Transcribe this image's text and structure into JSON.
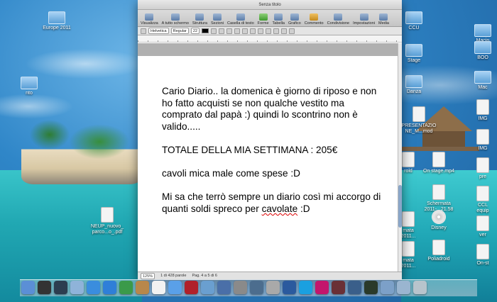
{
  "window": {
    "title": "Senza titolo"
  },
  "toolbar": [
    {
      "label": "Visualizza",
      "icon": "view-icon"
    },
    {
      "label": "A tutto schermo",
      "icon": "fullscreen-icon"
    },
    {
      "label": "Struttura",
      "icon": "structure-icon"
    },
    {
      "label": "Sezioni",
      "icon": "sections-icon"
    },
    {
      "label": "Casella di testo",
      "icon": "textbox-icon"
    },
    {
      "label": "Forme",
      "icon": "shapes-icon"
    },
    {
      "label": "Tabella",
      "icon": "table-icon"
    },
    {
      "label": "Grafico",
      "icon": "chart-icon"
    },
    {
      "label": "Commento",
      "icon": "comment-icon"
    },
    {
      "label": "Condivisione",
      "icon": "share-icon"
    },
    {
      "label": "Impostazioni",
      "icon": "inspector-icon"
    },
    {
      "label": "Media",
      "icon": "media-icon"
    }
  ],
  "format": {
    "font": "Helvetica",
    "style": "Regular",
    "size": "22"
  },
  "document": {
    "paragraphs": [
      "Cario Diario.. la domenica è giorno di riposo e non ho fatto acquisti se non qualche vestito ma comprato dal papà :) quindi  lo scontrino non è valido.....",
      "TOTALE DELLA MIA SETTIMANA : 205€",
      "cavoli mica male come spese :D"
    ],
    "last_paragraph_start": "Mi sa che terrò sempre un diario così mi accorgo di quanti soldi spreco per ",
    "last_paragraph_misspelled": "cavolate",
    "last_paragraph_end": " :D"
  },
  "status": {
    "zoom": "125%",
    "word_count": "1 di 428 parole",
    "page": "Pag. 4 a 5 di 6"
  },
  "desktop": {
    "left_icons": [
      {
        "label": "Europe 2011",
        "icon": "folder-icon"
      },
      {
        "label": "nto",
        "icon": "folder-icon"
      },
      {
        "label": "NEUP_nuovo_\nparco...o_.pdf",
        "icon": "pdf-icon"
      }
    ],
    "right_icons": [
      {
        "label": "CCU",
        "icon": "folder-icon"
      },
      {
        "label": "Stage",
        "icon": "folder-icon"
      },
      {
        "label": "Danza",
        "icon": "folder-icon"
      },
      {
        "label": "PRESENTAZIO\nNE_M...mod",
        "icon": "doc-icon"
      },
      {
        "label": "rold",
        "icon": "doc-icon"
      },
      {
        "label": "On stage.mp4",
        "icon": "video-icon"
      },
      {
        "label": "Schermata\n2011-...21.58",
        "icon": "screenshot-icon"
      },
      {
        "label": "mata\n2011...",
        "icon": "doc-icon"
      },
      {
        "label": "Disney",
        "icon": "disc-icon"
      },
      {
        "label": "mata\n2011...",
        "icon": "doc-icon"
      },
      {
        "label": "Poliadroid",
        "icon": "doc-icon"
      }
    ],
    "far_right_icons": [
      {
        "label": "Macin",
        "icon": "drive-icon"
      },
      {
        "label": "BOO",
        "icon": "drive-icon"
      },
      {
        "label": "Mac",
        "icon": "drive-icon"
      },
      {
        "label": "IMG",
        "icon": "image-icon"
      },
      {
        "label": "IMG",
        "icon": "image-icon"
      },
      {
        "label": "pre",
        "icon": "doc-icon"
      },
      {
        "label": "CCL\nequip",
        "icon": "doc-icon"
      },
      {
        "label": "ver",
        "icon": "doc-icon"
      },
      {
        "label": "On-st",
        "icon": "video-icon"
      }
    ]
  },
  "dock": {
    "apps": [
      {
        "name": "finder",
        "color": "#5b8fd6"
      },
      {
        "name": "dashboard",
        "color": "#333333"
      },
      {
        "name": "mission-control",
        "color": "#2c3e50"
      },
      {
        "name": "preview",
        "color": "#8fb3d9"
      },
      {
        "name": "safari",
        "color": "#3a8dde"
      },
      {
        "name": "app-store",
        "color": "#2f7fd8"
      },
      {
        "name": "facetime",
        "color": "#3b9a4a"
      },
      {
        "name": "address-book",
        "color": "#b8874b"
      },
      {
        "name": "ical",
        "color": "#f2f2f2"
      },
      {
        "name": "itunes",
        "color": "#5aa0e8"
      },
      {
        "name": "photo-booth",
        "color": "#b0202a"
      },
      {
        "name": "iphoto",
        "color": "#6a9fd0"
      },
      {
        "name": "keynote",
        "color": "#4a6fa8"
      },
      {
        "name": "system-preferences",
        "color": "#8a8a8a"
      },
      {
        "name": "time-machine",
        "color": "#4c6d8e"
      },
      {
        "name": "boot-camp",
        "color": "#a9a9a9"
      },
      {
        "name": "photoshop",
        "color": "#2b5a9e"
      },
      {
        "name": "skype",
        "color": "#1aa0e0"
      },
      {
        "name": "indesign",
        "color": "#c3166c"
      },
      {
        "name": "flash",
        "color": "#6a3036"
      },
      {
        "name": "network",
        "color": "#3a5f8a"
      },
      {
        "name": "activity-monitor",
        "color": "#2a3a2a"
      },
      {
        "name": "downloads",
        "color": "#7ca0c8"
      },
      {
        "name": "documents",
        "color": "#9ab5d0"
      },
      {
        "name": "trash",
        "color": "#b8c4cc"
      }
    ]
  }
}
